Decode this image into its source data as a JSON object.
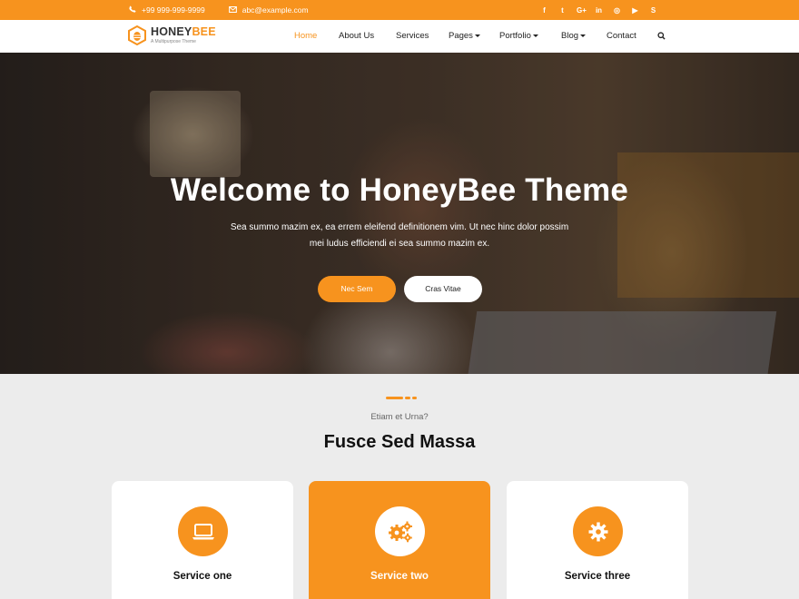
{
  "colors": {
    "accent": "#f7931e",
    "section_bg": "#ececec",
    "card_bg": "#ffffff"
  },
  "topbar": {
    "phone": "+99 999-999-9999",
    "email": "abc@example.com",
    "social_icons": [
      "facebook-icon",
      "twitter-icon",
      "google-plus-icon",
      "linkedin-icon",
      "instagram-icon",
      "youtube-icon",
      "skype-icon"
    ],
    "social_glyphs": [
      "f",
      "t",
      "G+",
      "in",
      "◎",
      "▶",
      "S"
    ]
  },
  "header": {
    "logo_honey": "HONEY",
    "logo_bee": "BEE",
    "logo_tagline": "A Multipurpose Theme",
    "nav": [
      "Home",
      "About Us",
      "Services",
      "Pages",
      "Portfolio",
      "Blog",
      "Contact"
    ],
    "active_nav": "Home"
  },
  "hero": {
    "title": "Welcome to HoneyBee Theme",
    "text_line1": "Sea summo mazim ex, ea errem eleifend definitionem vim. Ut nec hinc dolor possim",
    "text_line2": "mei ludus efficiendi ei sea summo mazim ex.",
    "primary_button": "Nec Sem",
    "secondary_button": "Cras Vitae"
  },
  "services": {
    "kicker": "Etiam et Urna?",
    "title": "Fusce Sed Massa",
    "cards": [
      {
        "title": "Service one",
        "icon": "laptop-icon"
      },
      {
        "title": "Service two",
        "icon": "gears-icon"
      },
      {
        "title": "Service three",
        "icon": "gear-icon"
      }
    ]
  }
}
